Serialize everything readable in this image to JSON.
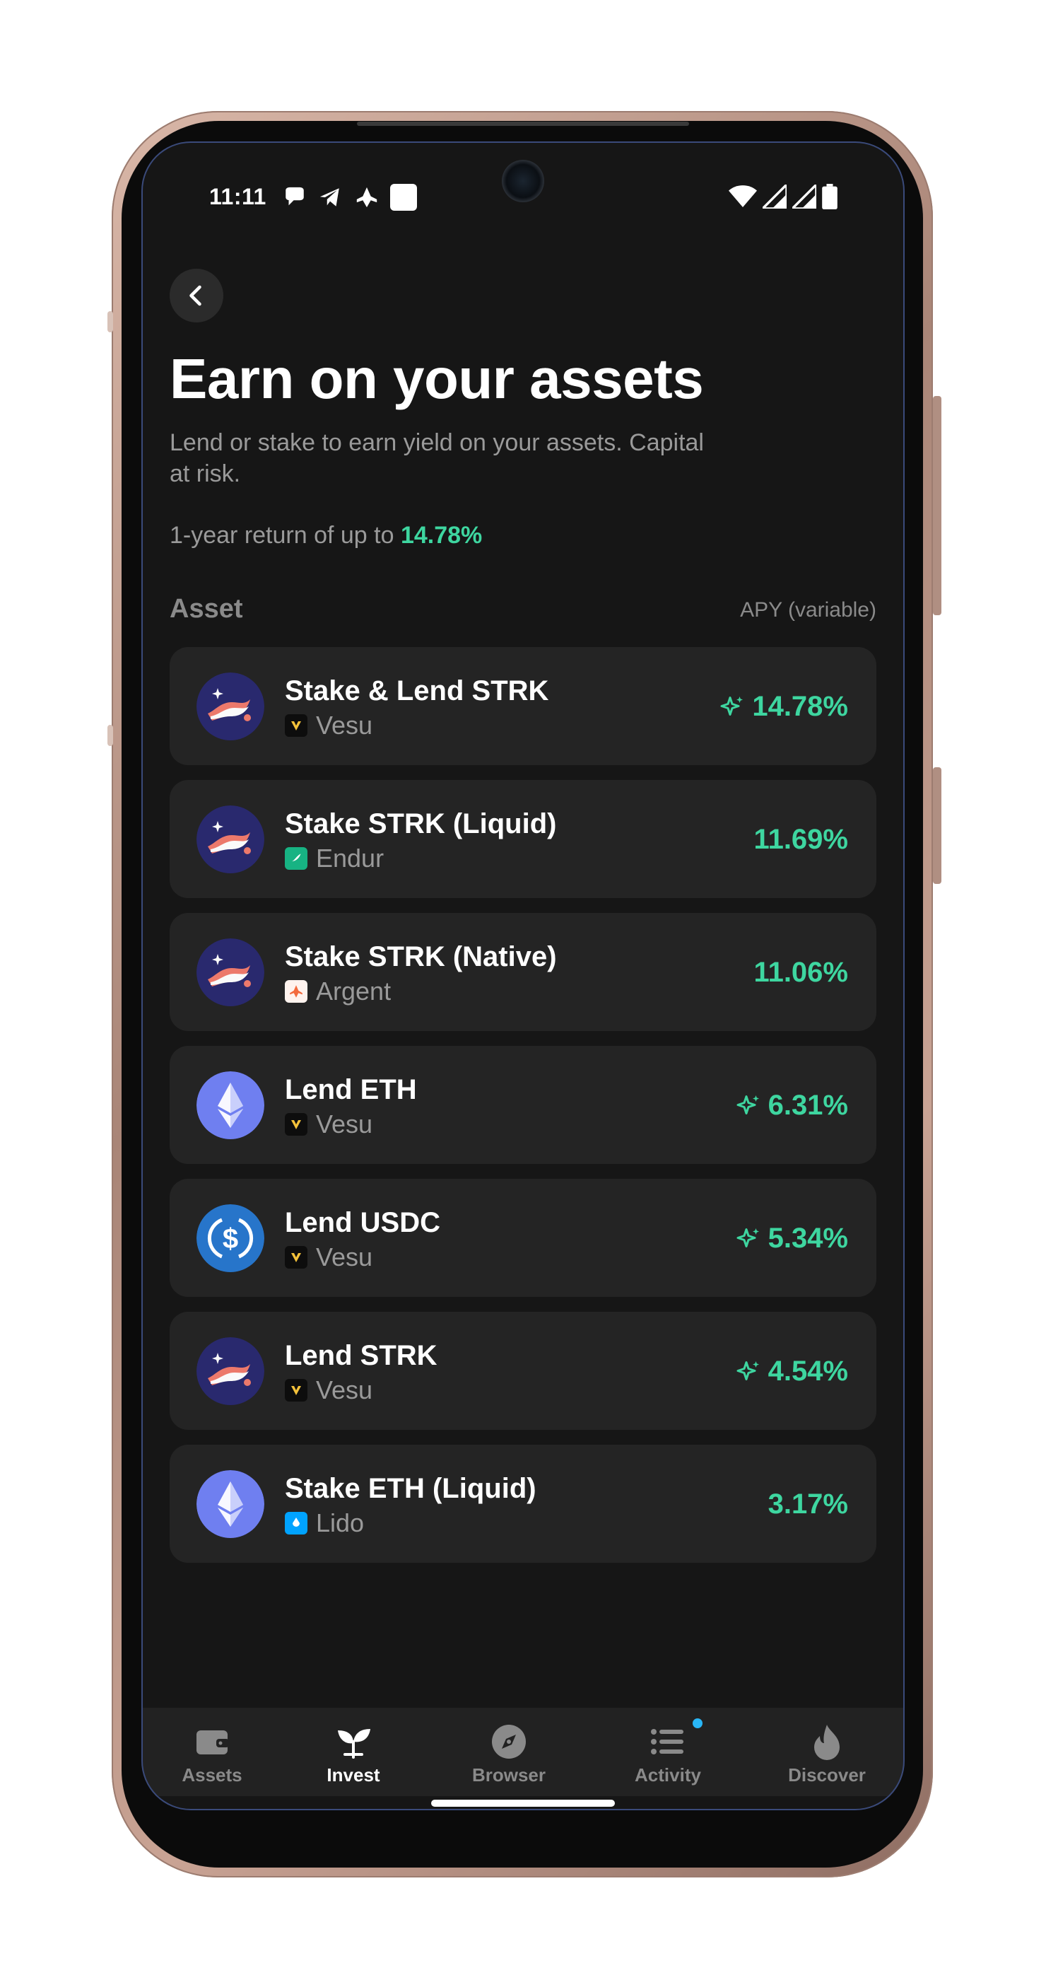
{
  "status_bar": {
    "time": "11:11",
    "notification_icons": [
      "chat-bubble-icon",
      "telegram-icon",
      "argent-icon",
      "square-app-icon"
    ],
    "system_icons": [
      "wifi-icon",
      "signal-icon",
      "signal-icon",
      "battery-icon"
    ]
  },
  "header": {
    "title": "Earn on your assets",
    "subtitle": "Lend or stake to earn yield on your assets. Capital at risk.",
    "return_prefix": "1-year return of up to ",
    "return_value": "14.78%"
  },
  "columns": {
    "asset": "Asset",
    "apy": "APY (variable)"
  },
  "items": [
    {
      "name": "Stake & Lend STRK",
      "provider": "Vesu",
      "provider_icon": "vesu-icon",
      "token_icon": "strk-icon",
      "apy": "14.78%",
      "boosted": true
    },
    {
      "name": "Stake STRK (Liquid)",
      "provider": "Endur",
      "provider_icon": "endur-icon",
      "token_icon": "strk-icon",
      "apy": "11.69%",
      "boosted": false
    },
    {
      "name": "Stake STRK (Native)",
      "provider": "Argent",
      "provider_icon": "argent-icon",
      "token_icon": "strk-icon",
      "apy": "11.06%",
      "boosted": false
    },
    {
      "name": "Lend ETH",
      "provider": "Vesu",
      "provider_icon": "vesu-icon",
      "token_icon": "eth-icon",
      "apy": "6.31%",
      "boosted": true
    },
    {
      "name": "Lend USDC",
      "provider": "Vesu",
      "provider_icon": "vesu-icon",
      "token_icon": "usdc-icon",
      "apy": "5.34%",
      "boosted": true
    },
    {
      "name": "Lend STRK",
      "provider": "Vesu",
      "provider_icon": "vesu-icon",
      "token_icon": "strk-icon",
      "apy": "4.54%",
      "boosted": true
    },
    {
      "name": "Stake ETH (Liquid)",
      "provider": "Lido",
      "provider_icon": "lido-icon",
      "token_icon": "eth-icon",
      "apy": "3.17%",
      "boosted": false
    }
  ],
  "nav": [
    {
      "label": "Assets",
      "icon": "wallet-icon",
      "active": false
    },
    {
      "label": "Invest",
      "icon": "sprout-icon",
      "active": true
    },
    {
      "label": "Browser",
      "icon": "compass-icon",
      "active": false
    },
    {
      "label": "Activity",
      "icon": "list-icon",
      "active": false,
      "badge": true
    },
    {
      "label": "Discover",
      "icon": "flame-icon",
      "active": false
    }
  ],
  "colors": {
    "background": "#161616",
    "card": "#242424",
    "accent_green": "#3ed6a0",
    "muted_text": "#9a9a9a",
    "badge_blue": "#29b6f6"
  }
}
